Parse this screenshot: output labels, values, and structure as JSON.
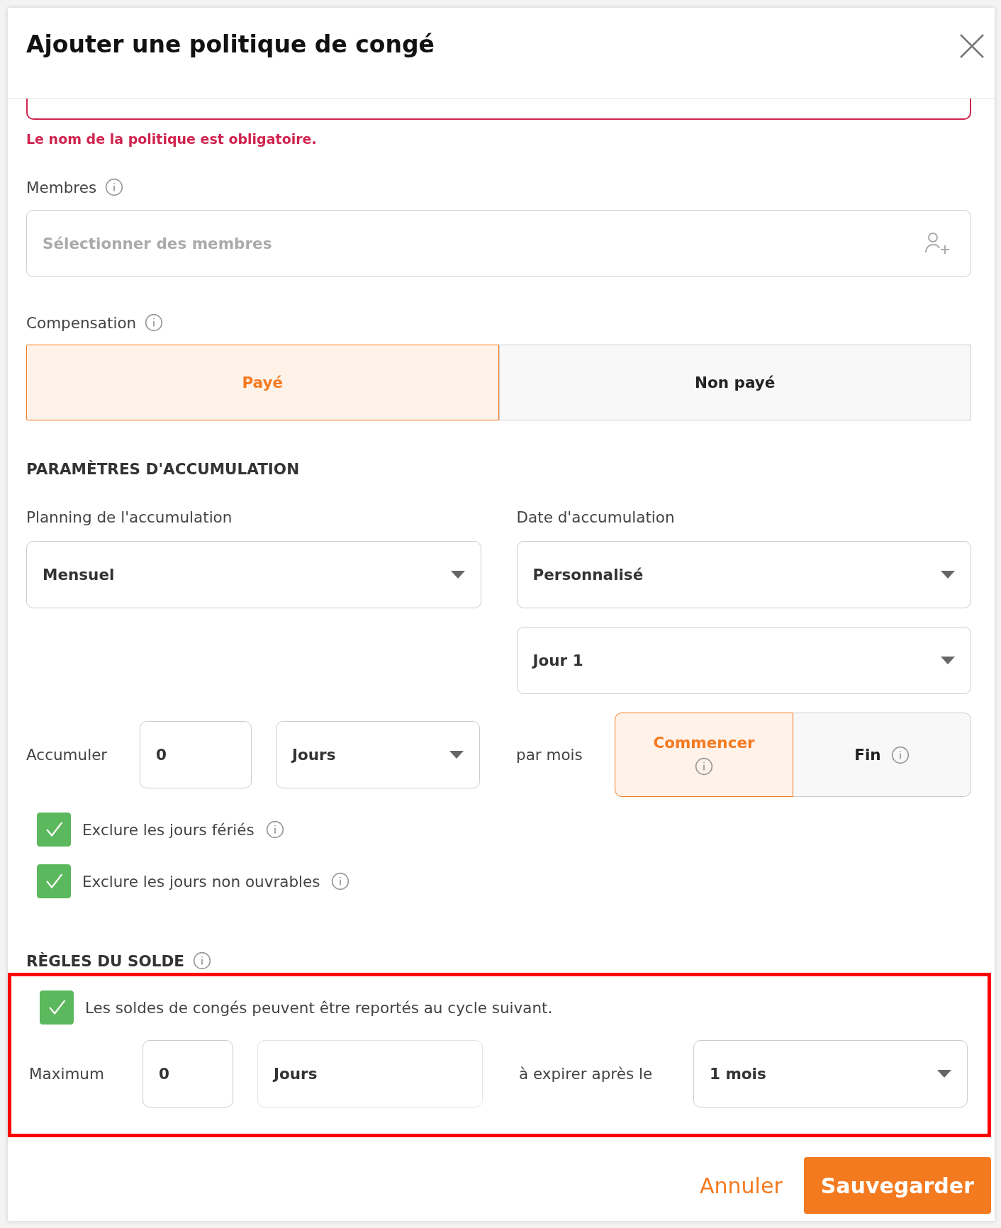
{
  "dialog": {
    "title": "Ajouter une politique de congé"
  },
  "name_field": {
    "error": true,
    "error_message": "Le nom de la politique est obligatoire."
  },
  "members": {
    "label": "Membres",
    "placeholder": "Sélectionner des membres"
  },
  "compensation": {
    "label": "Compensation",
    "options": [
      {
        "label": "Payé",
        "selected": true
      },
      {
        "label": "Non payé",
        "selected": false
      }
    ]
  },
  "accrual": {
    "heading": "PARAMÈTRES D'ACCUMULATION",
    "schedule": {
      "label": "Planning de l'accumulation",
      "value": "Mensuel"
    },
    "date": {
      "label": "Date d'accumulation",
      "value": "Personnalisé",
      "day_value": "Jour 1"
    },
    "accrue": {
      "label": "Accumuler",
      "amount": "0",
      "unit": "Jours",
      "period": "par mois",
      "timing": [
        {
          "label": "Commencer",
          "selected": true
        },
        {
          "label": "Fin",
          "selected": false
        }
      ]
    },
    "options": [
      {
        "label": "Exclure les jours fériés",
        "checked": true
      },
      {
        "label": "Exclure les jours non ouvrables",
        "checked": true
      }
    ]
  },
  "balance_rules": {
    "heading": "RÈGLES DU SOLDE",
    "highlighted": true,
    "carryover": {
      "label": "Les soldes de congés peuvent être reportés au cycle suivant.",
      "checked": true
    },
    "maximum_label": "Maximum",
    "maximum_value": "0",
    "maximum_unit": "Jours",
    "expire_label": "à expirer après le",
    "expire_value": "1 mois"
  },
  "footer": {
    "cancel": "Annuler",
    "save": "Sauvegarder"
  }
}
